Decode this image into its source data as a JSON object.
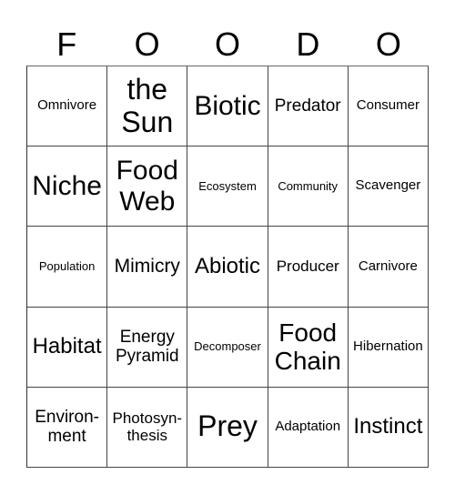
{
  "header": {
    "letters": [
      "F",
      "O",
      "O",
      "D",
      "O"
    ]
  },
  "board": {
    "rows": [
      [
        "Omnivore",
        "the Sun",
        "Biotic",
        "Predator",
        "Consumer"
      ],
      [
        "Niche",
        "Food Web",
        "Ecosystem",
        "Community",
        "Scavenger"
      ],
      [
        "Population",
        "Mimicry",
        "Abiotic",
        "Producer",
        "Carnivore"
      ],
      [
        "Habitat",
        "Energy Pyramid",
        "Decomposer",
        "Food Chain",
        "Hibernation"
      ],
      [
        "Environ- ment",
        "Photosyn- thesis",
        "Prey",
        "Adaptation",
        "Instinct"
      ]
    ]
  }
}
